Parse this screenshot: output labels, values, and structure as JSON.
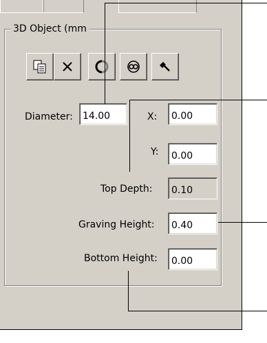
{
  "group": {
    "title": "3D Object (mm"
  },
  "toolbar": [
    {
      "icon": "copy-icon"
    },
    {
      "icon": "delete-icon"
    },
    {
      "icon": "rotate-icon"
    },
    {
      "icon": "link-icon"
    },
    {
      "icon": "hammer-icon"
    }
  ],
  "fields": {
    "diameter": {
      "label": "Diameter:",
      "value": "14.00"
    },
    "x": {
      "label": "X:",
      "value": "0.00"
    },
    "y": {
      "label": "Y:",
      "value": "0.00"
    },
    "top_depth": {
      "label": "Top Depth:",
      "value": "0.10"
    },
    "graving_height": {
      "label": "Graving Height:",
      "value": "0.40"
    },
    "bottom_height": {
      "label": "Bottom Height:",
      "value": "0.00"
    }
  }
}
